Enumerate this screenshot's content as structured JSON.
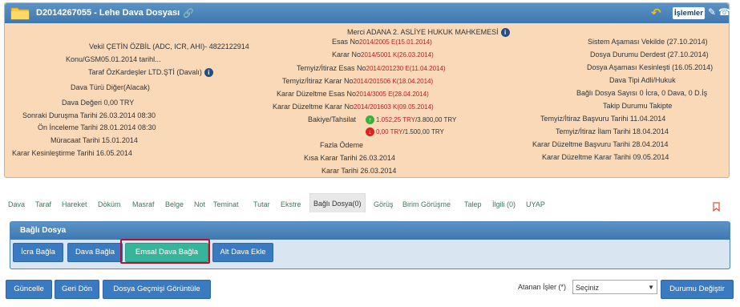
{
  "header": {
    "title": "D2014267055 - Lehe Dava Dosyası",
    "islemler_label": "İşlemler",
    "colors": {
      "header_bg": "#4a86be",
      "panel_bg": "#fad9b8",
      "accent_green": "#37b59a",
      "accent_blue": "#3a7ac0",
      "highlight_red": "#b7122d"
    }
  },
  "left": {
    "vekil_label": "Vekil",
    "vekil_value": "ÇETİN ÖZBİL (ADC, ICR, AHI)- 4822122914",
    "konu_label": "Konu/GSM",
    "konu_value": "05.01.2014 tarihl...",
    "taraf_label": "Taraf",
    "taraf_value": "ÖzKardeşler LTD.ŞTİ  (Davalı)",
    "dava_turu_label": "Dava Türü",
    "dava_turu_value": "Diğer(Alacak)",
    "dava_degeri_label": "Dava Değeri",
    "dava_degeri_value": "0,00 TRY",
    "sonraki_label": "Sonraki Duruşma Tarihi",
    "sonraki_value": "26.03.2014 08:30",
    "on_inceleme_label": "Ön İnceleme Tarihi",
    "on_inceleme_value": "28.01.2014 08:30",
    "muracaat_label": "Müracaat Tarihi",
    "muracaat_value": "15.01.2014",
    "karar_kes_label": "Karar Kesinleştirme Tarihi",
    "karar_kes_value": "16.05.2014"
  },
  "middle": {
    "merci_label": "Merci",
    "merci_value": "ADANA 2. ASLİYE HUKUK MAHKEMESİ",
    "esas_no_label": "Esas No",
    "esas_no_value": "2014/2005 E(15.01.2014)",
    "karar_no_label": "Karar No",
    "karar_no_value": "2014/5001 K(26.03.2014)",
    "temyiz_esas_label": "Temyiz/İtiraz Esas No",
    "temyiz_esas_value": "2014/201230 E(11.04.2014)",
    "temyiz_karar_label": "Temyiz/İtiraz Karar No",
    "temyiz_karar_value": "2014/201506 K(18.04.2014)",
    "kd_esas_label": "Karar Düzeltme Esas No",
    "kd_esas_value": "2014/3005 E(28.04.2014)",
    "kd_karar_label": "Karar Düzeltme Karar No",
    "kd_karar_value": "2014/201603 K(09.05.2014)",
    "bakiye_label": "Bakiye/Tahsilat",
    "bakiye_up_a": "1.052,25 TRY",
    "bakiye_up_b": "/3.800,00 TRY",
    "bakiye_dn_a": "0,00 TRY",
    "bakiye_dn_b": "/1.500,00 TRY",
    "fazla_label": "Fazla Ödeme",
    "kisa_karar_label": "Kısa Karar Tarihi",
    "kisa_karar_value": "26.03.2014",
    "karar_tarihi_label": "Karar Tarihi",
    "karar_tarihi_value": "26.03.2014"
  },
  "right": {
    "sistem_label": "Sistem Aşaması",
    "sistem_value": "Vekilde (27.10.2014)",
    "durum_label": "Dosya Durumu",
    "durum_value": "Derdest (27.10.2014)",
    "asama_label": "Dosya Aşaması",
    "asama_value": "Kesinleşti (16.05.2014)",
    "dava_tipi_label": "Dava Tipi",
    "dava_tipi_value": "Adli/Hukuk",
    "bagli_sayisi_label": "Bağlı Dosya Sayısı",
    "bagli_sayisi_value": "0 İcra, 0 Dava, 0 D.İş",
    "takip_label": "Takip Durumu",
    "takip_value": "Takipte",
    "tb_label": "Temyiz/İtiraz Başvuru Tarihi",
    "tb_value": "11.04.2014",
    "ti_label": "Temyiz/İtiraz İlam Tarihi",
    "ti_value": "18.04.2014",
    "kdb_label": "Karar Düzeltme Başvuru Tarihi",
    "kdb_value": "28.04.2014",
    "kdk_label": "Karar Düzeltme Karar Tarihi",
    "kdk_value": "09.05.2014"
  },
  "tabs": [
    {
      "label": "Dava"
    },
    {
      "label": "Taraf"
    },
    {
      "label": "Hareket"
    },
    {
      "label": "Döküm"
    },
    {
      "label": "Masraf"
    },
    {
      "label": "Belge"
    },
    {
      "label": "Not"
    },
    {
      "label": "Teminat"
    },
    {
      "label": "Tutar"
    },
    {
      "label": "Ekstre"
    },
    {
      "label": "Bağlı Dosya(0)"
    },
    {
      "label": "Görüş"
    },
    {
      "label": "Birim Görüşme"
    },
    {
      "label": "Talep"
    },
    {
      "label": "İlgili (0)"
    },
    {
      "label": "UYAP"
    }
  ],
  "subpanel": {
    "title": "Bağlı Dosya",
    "btn_icra": "İcra Bağla",
    "btn_dava": "Dava Bağla",
    "btn_emsal": "Emsal Dava Bağla",
    "btn_alt": "Alt Dava Ekle"
  },
  "footer": {
    "btn_guncelle": "Güncelle",
    "btn_geri": "Geri Dön",
    "btn_gecmis": "Dosya Geçmişi Görüntüle",
    "atanan_label": "Atanan İşler (*)",
    "atanan_value": "Seçiniz",
    "btn_durum": "Durumu Değiştir"
  }
}
